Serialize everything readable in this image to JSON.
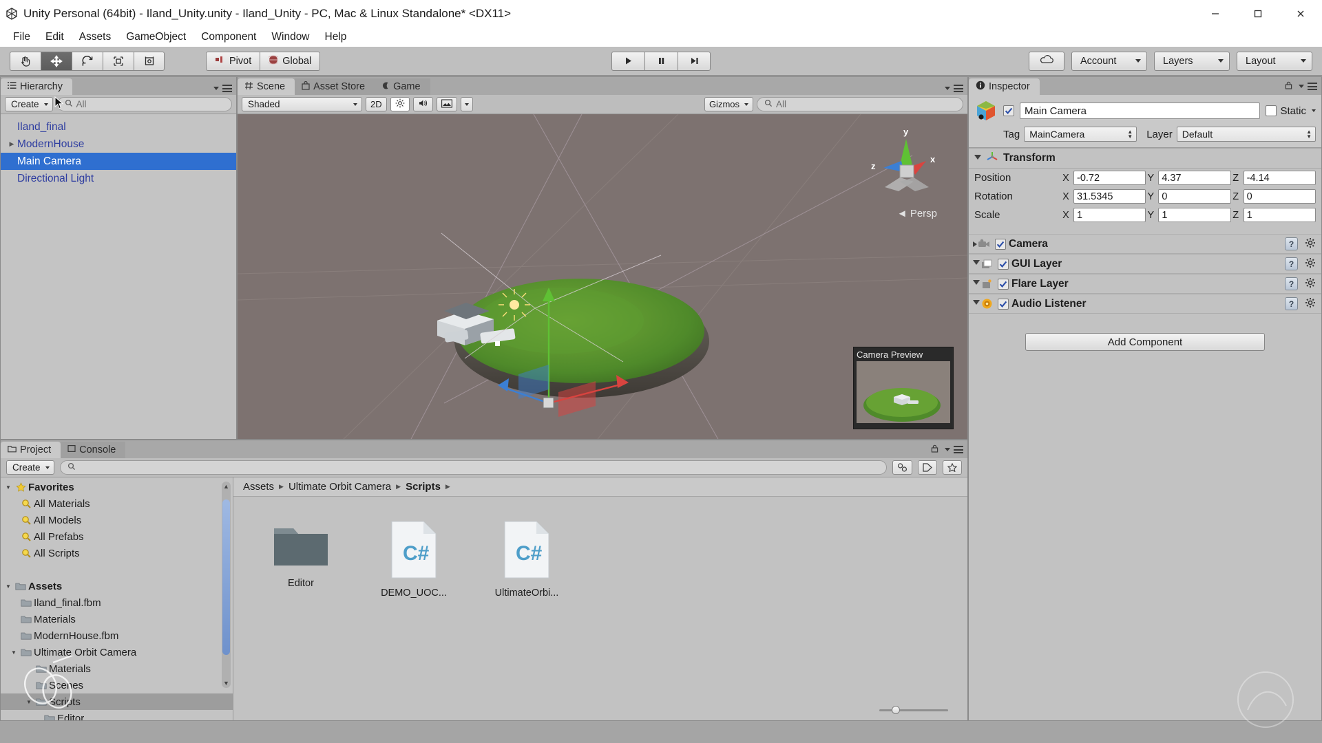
{
  "window": {
    "title": "Unity Personal (64bit) - Iland_Unity.unity - Iland_Unity - PC, Mac & Linux Standalone* <DX11>",
    "minimize_label": "Minimize",
    "maximize_label": "Maximize",
    "close_label": "Close"
  },
  "menubar": {
    "items": [
      {
        "label": "File"
      },
      {
        "label": "Edit"
      },
      {
        "label": "Assets"
      },
      {
        "label": "GameObject"
      },
      {
        "label": "Component"
      },
      {
        "label": "Window"
      },
      {
        "label": "Help"
      }
    ]
  },
  "toolbar": {
    "tools": [
      {
        "name": "hand-tool",
        "icon": "hand-icon",
        "active": false
      },
      {
        "name": "move-tool",
        "icon": "move-icon",
        "active": true
      },
      {
        "name": "rotate-tool",
        "icon": "rotate-icon",
        "active": false
      },
      {
        "name": "scale-tool",
        "icon": "scale-icon",
        "active": false
      },
      {
        "name": "rect-tool",
        "icon": "rect-transform-icon",
        "active": false
      }
    ],
    "pivot_label": "Pivot",
    "global_label": "Global",
    "play_label": "Play",
    "pause_label": "Pause",
    "step_label": "Step",
    "cloud_label": "Collab",
    "account_label": "Account",
    "layers_label": "Layers",
    "layout_label": "Layout"
  },
  "hierarchy": {
    "tab_label": "Hierarchy",
    "create_label": "Create",
    "search_placeholder": "All",
    "items": [
      {
        "label": "Iland_final",
        "expandable": false,
        "selected": false
      },
      {
        "label": "ModernHouse",
        "expandable": true,
        "selected": false
      },
      {
        "label": "Main Camera",
        "expandable": false,
        "selected": true
      },
      {
        "label": "Directional Light",
        "expandable": false,
        "selected": false
      }
    ]
  },
  "scene": {
    "tabs": [
      {
        "label": "Scene",
        "icon": "scene-grid-icon",
        "active": true
      },
      {
        "label": "Asset Store",
        "icon": "store-icon",
        "active": false
      },
      {
        "label": "Game",
        "icon": "gamepad-icon",
        "active": false
      }
    ],
    "shading_mode": "Shaded",
    "twod_label": "2D",
    "lighting_label": "Lighting toggle",
    "audio_label": "Audio toggle",
    "effects_label": "Effects",
    "gizmos_label": "Gizmos",
    "search_placeholder": "All",
    "axes": {
      "x": "x",
      "y": "y",
      "z": "z"
    },
    "projection_label": "Persp",
    "camera_preview_title": "Camera Preview"
  },
  "inspector": {
    "tab_label": "Inspector",
    "object_name": "Main Camera",
    "enabled": true,
    "static_label": "Static",
    "static_checked": false,
    "tag_label": "Tag",
    "tag_value": "MainCamera",
    "layer_label": "Layer",
    "layer_value": "Default",
    "transform": {
      "title": "Transform",
      "rows": [
        {
          "label": "Position",
          "x": "-0.72",
          "y": "4.37",
          "z": "-4.14"
        },
        {
          "label": "Rotation",
          "x": "31.5345",
          "y": "0",
          "z": "0"
        },
        {
          "label": "Scale",
          "x": "1",
          "y": "1",
          "z": "1"
        }
      ],
      "axis_labels": {
        "x": "X",
        "y": "Y",
        "z": "Z"
      }
    },
    "components": [
      {
        "label": "Camera",
        "icon": "camera-icon",
        "enabled": true,
        "expanded": false
      },
      {
        "label": "GUI Layer",
        "icon": "gui-layer-icon",
        "enabled": true,
        "expanded": true
      },
      {
        "label": "Flare Layer",
        "icon": "flare-layer-icon",
        "enabled": true,
        "expanded": true
      },
      {
        "label": "Audio Listener",
        "icon": "audio-listener-icon",
        "enabled": true,
        "expanded": true
      }
    ],
    "add_component_label": "Add Component"
  },
  "project": {
    "tabs": [
      {
        "label": "Project",
        "active": true
      },
      {
        "label": "Console",
        "active": false
      }
    ],
    "create_label": "Create",
    "search_placeholder": "",
    "breadcrumbs": [
      {
        "label": "Assets",
        "current": false
      },
      {
        "label": "Ultimate Orbit Camera",
        "current": false
      },
      {
        "label": "Scripts",
        "current": true
      }
    ],
    "tree": [
      {
        "label": "Favorites",
        "icon": "star-icon",
        "indent": 0,
        "arrow": "down",
        "bold": true,
        "selected": false
      },
      {
        "label": "All Materials",
        "icon": "search-icon",
        "indent": 1,
        "arrow": "",
        "bold": false,
        "selected": false
      },
      {
        "label": "All Models",
        "icon": "search-icon",
        "indent": 1,
        "arrow": "",
        "bold": false,
        "selected": false
      },
      {
        "label": "All Prefabs",
        "icon": "search-icon",
        "indent": 1,
        "arrow": "",
        "bold": false,
        "selected": false
      },
      {
        "label": "All Scripts",
        "icon": "search-icon",
        "indent": 1,
        "arrow": "",
        "bold": false,
        "selected": false
      },
      {
        "label": "",
        "icon": "",
        "indent": 0,
        "arrow": "",
        "bold": false,
        "selected": false
      },
      {
        "label": "Assets",
        "icon": "folder-icon",
        "indent": 0,
        "arrow": "down",
        "bold": true,
        "selected": false
      },
      {
        "label": "Iland_final.fbm",
        "icon": "folder-icon",
        "indent": 1,
        "arrow": "",
        "bold": false,
        "selected": false
      },
      {
        "label": "Materials",
        "icon": "folder-icon",
        "indent": 1,
        "arrow": "",
        "bold": false,
        "selected": false
      },
      {
        "label": "ModernHouse.fbm",
        "icon": "folder-icon",
        "indent": 1,
        "arrow": "",
        "bold": false,
        "selected": false
      },
      {
        "label": "Ultimate Orbit Camera",
        "icon": "folder-icon",
        "indent": 1,
        "arrow": "down",
        "bold": false,
        "selected": false
      },
      {
        "label": "Materials",
        "icon": "folder-icon",
        "indent": 2,
        "arrow": "",
        "bold": false,
        "selected": false
      },
      {
        "label": "Scenes",
        "icon": "folder-icon",
        "indent": 2,
        "arrow": "",
        "bold": false,
        "selected": false
      },
      {
        "label": "Scripts",
        "icon": "folder-icon",
        "indent": 2,
        "arrow": "down",
        "bold": false,
        "selected": true
      },
      {
        "label": "Editor",
        "icon": "folder-icon",
        "indent": 3,
        "arrow": "",
        "bold": false,
        "selected": false
      }
    ],
    "assets": [
      {
        "label": "Editor",
        "type": "folder"
      },
      {
        "label": "DEMO_UOC...",
        "type": "csharp"
      },
      {
        "label": "UltimateOrbi...",
        "type": "csharp"
      }
    ],
    "csharp_glyph": "C#"
  },
  "colors": {
    "selection_blue": "#2f6fd0",
    "panel_bg": "#c2c2c2",
    "toolbar_bg": "#bfbfbf",
    "viewport_bg": "#7d7270",
    "axis_x": "#d9443f",
    "axis_y": "#5fc134",
    "axis_z": "#3b7fd4",
    "hierarchy_text": "#2e3da0"
  }
}
